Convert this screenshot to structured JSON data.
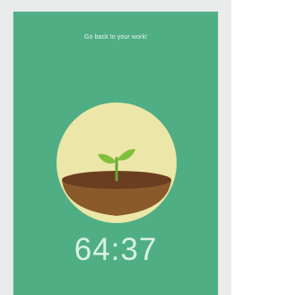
{
  "app": {
    "message": "Go back to your work!",
    "timer": "64:37"
  },
  "colors": {
    "background": "#4fae84",
    "circle": "#ece7a8",
    "soil_top": "#6a3e1f",
    "soil_bowl": "#8a5a2b",
    "leaf": "#7fbf3b"
  },
  "icons": {
    "plant": "sprout-icon"
  }
}
